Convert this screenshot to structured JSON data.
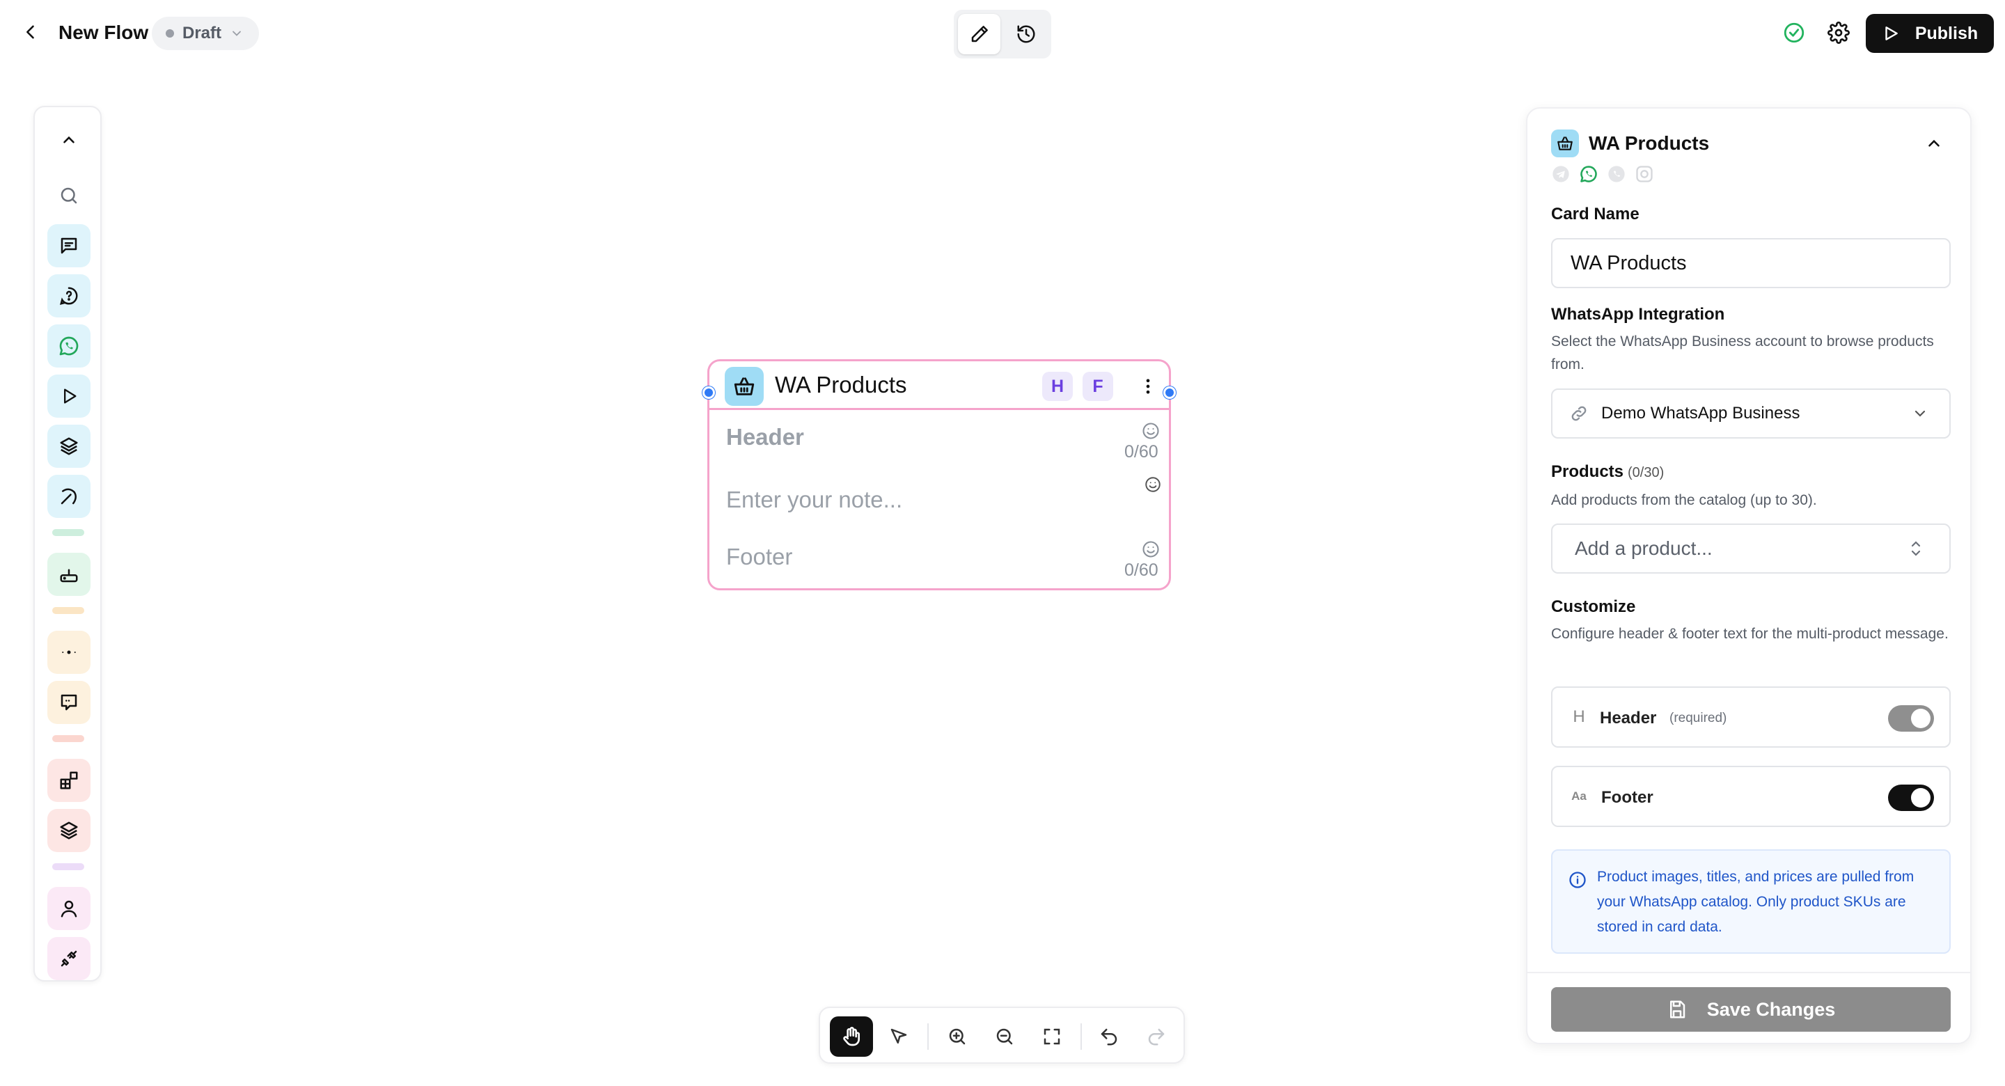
{
  "topbar": {
    "title": "New Flow",
    "status": "Draft",
    "publish_label": "Publish"
  },
  "node": {
    "title": "WA Products",
    "badge_h": "H",
    "badge_f": "F",
    "header_placeholder": "Header",
    "header_counter": "0/60",
    "note_placeholder": "Enter your note...",
    "footer_placeholder": "Footer",
    "footer_counter": "0/60"
  },
  "panel": {
    "title": "WA Products",
    "card_name_label": "Card Name",
    "card_name_value": "WA Products",
    "integration_label": "WhatsApp Integration",
    "integration_help": "Select the WhatsApp Business account to browse products from.",
    "integration_value": "Demo WhatsApp Business",
    "products_label": "Products",
    "products_count": "(0/30)",
    "products_help": "Add products from the catalog (up to 30).",
    "products_placeholder": "Add a product...",
    "customize_label": "Customize",
    "customize_help": "Configure header & footer text for the multi-product message.",
    "header_toggle": {
      "icon_text": "H",
      "label": "Header",
      "note": "(required)",
      "on": true,
      "disabled": true
    },
    "footer_toggle": {
      "icon_text": "Aa",
      "label": "Footer",
      "on": true,
      "disabled": false
    },
    "info_text": "Product images, titles, and prices are pulled from your WhatsApp catalog. Only product SKUs are stored in card data.",
    "save_label": "Save Changes"
  },
  "colors": {
    "accent_dark": "#111111",
    "node_border": "#f5a3cb",
    "badge_purple": "#6b3fe0",
    "info_blue": "#1f55c8",
    "handle_blue": "#2f7af5",
    "success_green": "#22b35e",
    "save_disabled": "#8c8c8c"
  },
  "icons": {
    "palette": [
      "chevron-up-icon",
      "search-icon",
      "message-icon",
      "question-bubble-icon",
      "whatsapp-icon",
      "play-icon",
      "layers-icon",
      "pickaxe-icon",
      "router-icon",
      "dots-icon",
      "message-square-icon",
      "blocks-icon",
      "stack-icon",
      "user-icon",
      "plug-icon"
    ],
    "toolbar": [
      "hand-icon",
      "pointer-icon",
      "zoom-in-icon",
      "zoom-out-icon",
      "fit-view-icon",
      "undo-icon",
      "redo-icon"
    ]
  }
}
